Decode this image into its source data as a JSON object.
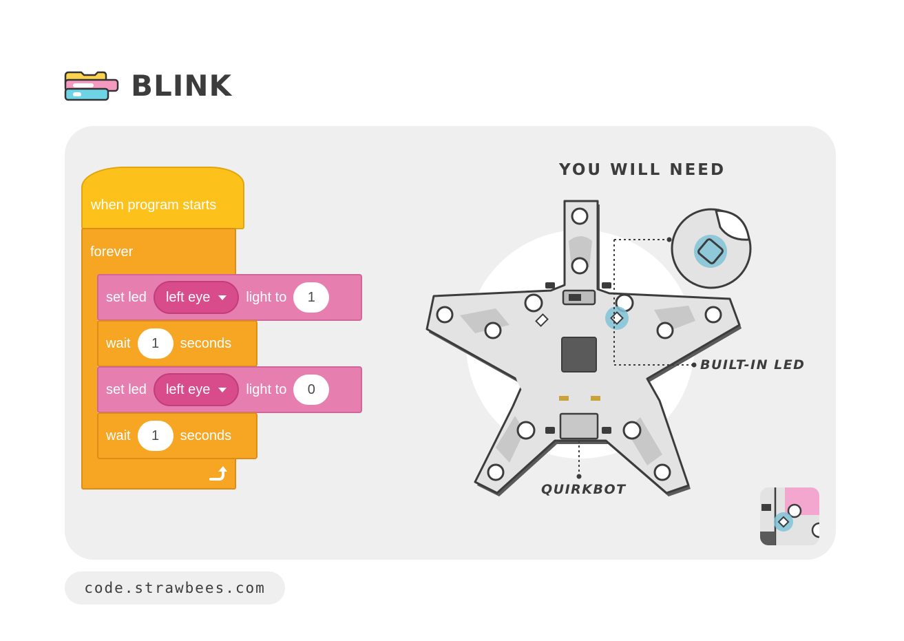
{
  "header": {
    "title": "BLINK",
    "icon": "code-blocks-icon"
  },
  "program": {
    "hat_label": "when program starts",
    "forever_label": "forever",
    "steps": [
      {
        "kind": "set_led",
        "label": "set led",
        "dropdown": "left eye",
        "light_label": "light to",
        "value": "1"
      },
      {
        "kind": "wait",
        "label": "wait",
        "value": "1",
        "unit": "seconds"
      },
      {
        "kind": "set_led",
        "label": "set led",
        "dropdown": "left eye",
        "light_label": "light to",
        "value": "0"
      },
      {
        "kind": "wait",
        "label": "wait",
        "value": "1",
        "unit": "seconds"
      }
    ],
    "loop_icon": "loop-arrow-icon"
  },
  "requirements": {
    "title": "YOU WILL NEED",
    "builtin_led_label": "BUILT-IN LED",
    "board_label": "QUIRKBOT"
  },
  "colors": {
    "hat": "#fcc21b",
    "control": "#f6a623",
    "led": "#e67fb0",
    "led_dropdown": "#d94c8c",
    "highlight": "#7fc3d7",
    "card": "#efefef"
  },
  "footer": {
    "url": "code.strawbees.com"
  }
}
